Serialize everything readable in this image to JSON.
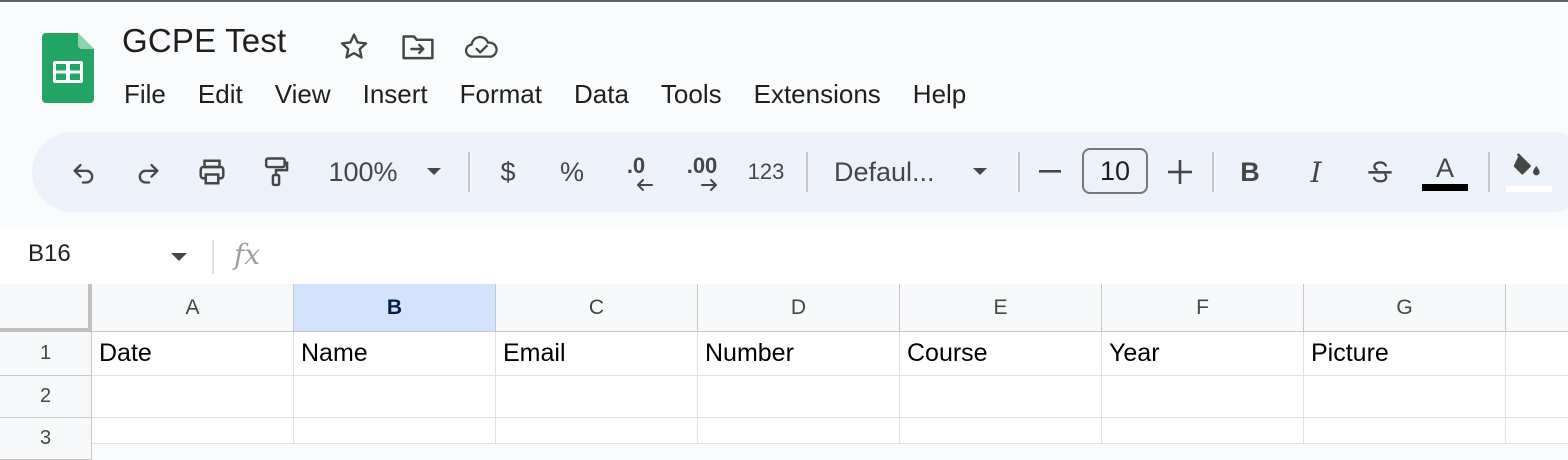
{
  "app": {
    "doc_title": "GCPE Test",
    "title_icons": [
      "star-icon",
      "move-folder-icon",
      "cloud-saved-icon"
    ],
    "logo": "google-sheets-logo",
    "brand_color": "#23a566"
  },
  "menu": [
    "File",
    "Edit",
    "View",
    "Insert",
    "Format",
    "Data",
    "Tools",
    "Extensions",
    "Help"
  ],
  "toolbar": {
    "zoom": "100%",
    "currency": "$",
    "percent": "%",
    "decrease_decimal": ".0",
    "increase_decimal": ".00",
    "number_format": "123",
    "font": "Defaul...",
    "font_size": "10",
    "bold": "B",
    "italic": "I",
    "text_color_glyph": "A",
    "text_color": "#000000"
  },
  "formula_bar": {
    "name_box": "B16",
    "fx": "fx",
    "value": ""
  },
  "sheet": {
    "columns": [
      "A",
      "B",
      "C",
      "D",
      "E",
      "F",
      "G"
    ],
    "selected_column": "B",
    "rows": [
      {
        "number": "1",
        "cells": [
          "Date",
          "Name",
          "Email",
          "Number",
          "Course",
          "Year",
          "Picture"
        ]
      },
      {
        "number": "2",
        "cells": [
          "",
          "",
          "",
          "",
          "",
          "",
          ""
        ]
      },
      {
        "number": "3",
        "cells": [
          "",
          "",
          "",
          "",
          "",
          "",
          ""
        ]
      }
    ]
  }
}
